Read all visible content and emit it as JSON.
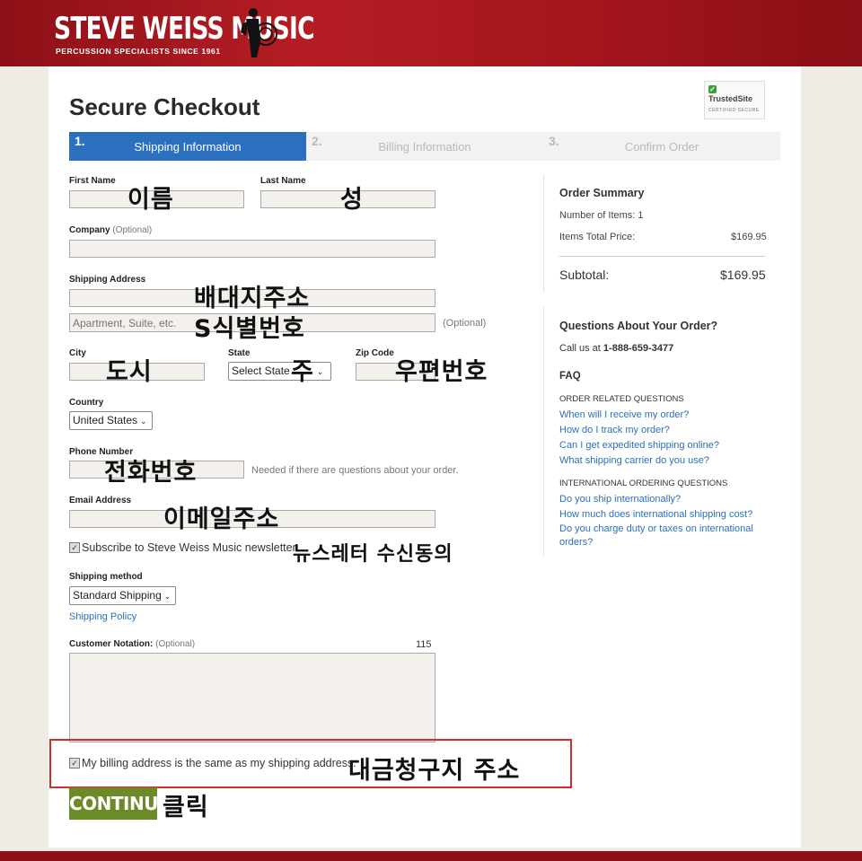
{
  "header": {
    "brand": "STEVE WEISS MUSIC",
    "tagline": "PERCUSSION SPECIALISTS SINCE 1961",
    "brand_color": "#a3151c"
  },
  "page_title": "Secure Checkout",
  "trust_badge": {
    "title": "TrustedSite",
    "sub": "CERTIFIED SECURE"
  },
  "steps": [
    {
      "num": "1.",
      "label": "Shipping Information",
      "active": true
    },
    {
      "num": "2.",
      "label": "Billing Information",
      "active": false
    },
    {
      "num": "3.",
      "label": "Confirm Order",
      "active": false
    }
  ],
  "form": {
    "first_name_label": "First Name",
    "last_name_label": "Last Name",
    "company_label": "Company",
    "optional": "(Optional)",
    "shipping_address_label": "Shipping Address",
    "apt_placeholder": "Apartment, Suite, etc.",
    "city_label": "City",
    "state_label": "State",
    "state_value": "Select State",
    "zip_label": "Zip Code",
    "country_label": "Country",
    "country_value": "United States",
    "phone_label": "Phone Number",
    "phone_note": "Needed if there are questions about your order.",
    "email_label": "Email Address",
    "newsletter_label": "Subscribe to Steve Weiss Music newsletter.",
    "shipping_method_label": "Shipping method",
    "shipping_method_value": "Standard Shipping",
    "shipping_policy": "Shipping Policy",
    "notation_label": "Customer Notation:",
    "notation_count": "115",
    "billing_same_label": "My billing address is the same as my shipping address.",
    "continue_label": "CONTINUE"
  },
  "annotations": {
    "first_name": "이름",
    "last_name": "성",
    "address": "배대지주소",
    "suite": "S식별번호",
    "city": "도시",
    "state": "주",
    "zip": "우편번호",
    "phone": "전화번호",
    "email": "이메일주소",
    "newsletter": "뉴스레터 수신동의",
    "billing": "대금청구지 주소",
    "click": "클릭"
  },
  "order_summary": {
    "title": "Order Summary",
    "items_label": "Number of Items: 1",
    "items_total_label": "Items Total Price:",
    "items_total_value": "$169.95",
    "subtotal_label": "Subtotal:",
    "subtotal_value": "$169.95"
  },
  "questions": {
    "title": "Questions About Your Order?",
    "call_prefix": "Call us at ",
    "phone": "1-888-659-3477",
    "faq_title": "FAQ",
    "order_related_title": "ORDER RELATED QUESTIONS",
    "order_related": [
      "When will I receive my order?",
      "How do I track my order?",
      "Can I get expedited shipping online?",
      "What shipping carrier do you use?"
    ],
    "international_title": "INTERNATIONAL ORDERING QUESTIONS",
    "international": [
      "Do you ship internationally?",
      "How much does international shipping cost?",
      "Do you charge duty or taxes on international",
      "orders?"
    ]
  },
  "colors": {
    "step_active": "#2b6fbf",
    "link": "#2b6fbf",
    "continue": "#6b8b28",
    "highlight_box": "#d32a2a"
  }
}
